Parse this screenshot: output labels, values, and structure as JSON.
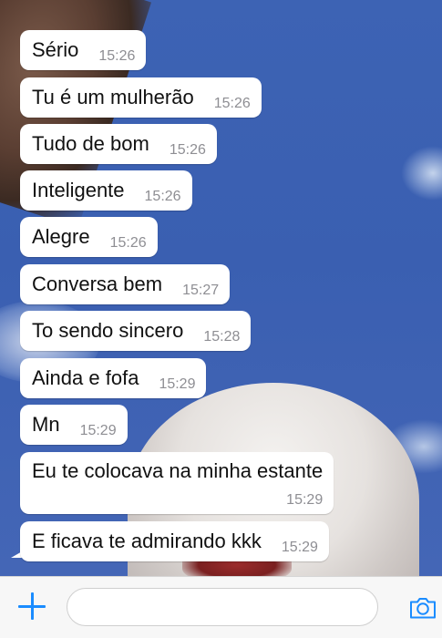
{
  "messages": [
    {
      "text": "Sério",
      "time": "15:26"
    },
    {
      "text": "Tu é um mulherão",
      "time": "15:26"
    },
    {
      "text": "Tudo de bom",
      "time": "15:26"
    },
    {
      "text": "Inteligente",
      "time": "15:26"
    },
    {
      "text": "Alegre",
      "time": "15:26"
    },
    {
      "text": "Conversa bem",
      "time": "15:27"
    },
    {
      "text": "To sendo sincero",
      "time": "15:28"
    },
    {
      "text": "Ainda e fofa",
      "time": "15:29"
    },
    {
      "text": "Mn",
      "time": "15:29"
    },
    {
      "text": "Eu te colocava na minha estante",
      "time": "15:29"
    },
    {
      "text": "E ficava te admirando kkk",
      "time": "15:29"
    }
  ],
  "input_bar": {
    "message_placeholder": "",
    "plus_icon": "plus-icon",
    "camera_icon": "camera-icon"
  },
  "colors": {
    "accent": "#1a8cff",
    "bubble": "#ffffff",
    "timestamp": "#8e8e93"
  }
}
